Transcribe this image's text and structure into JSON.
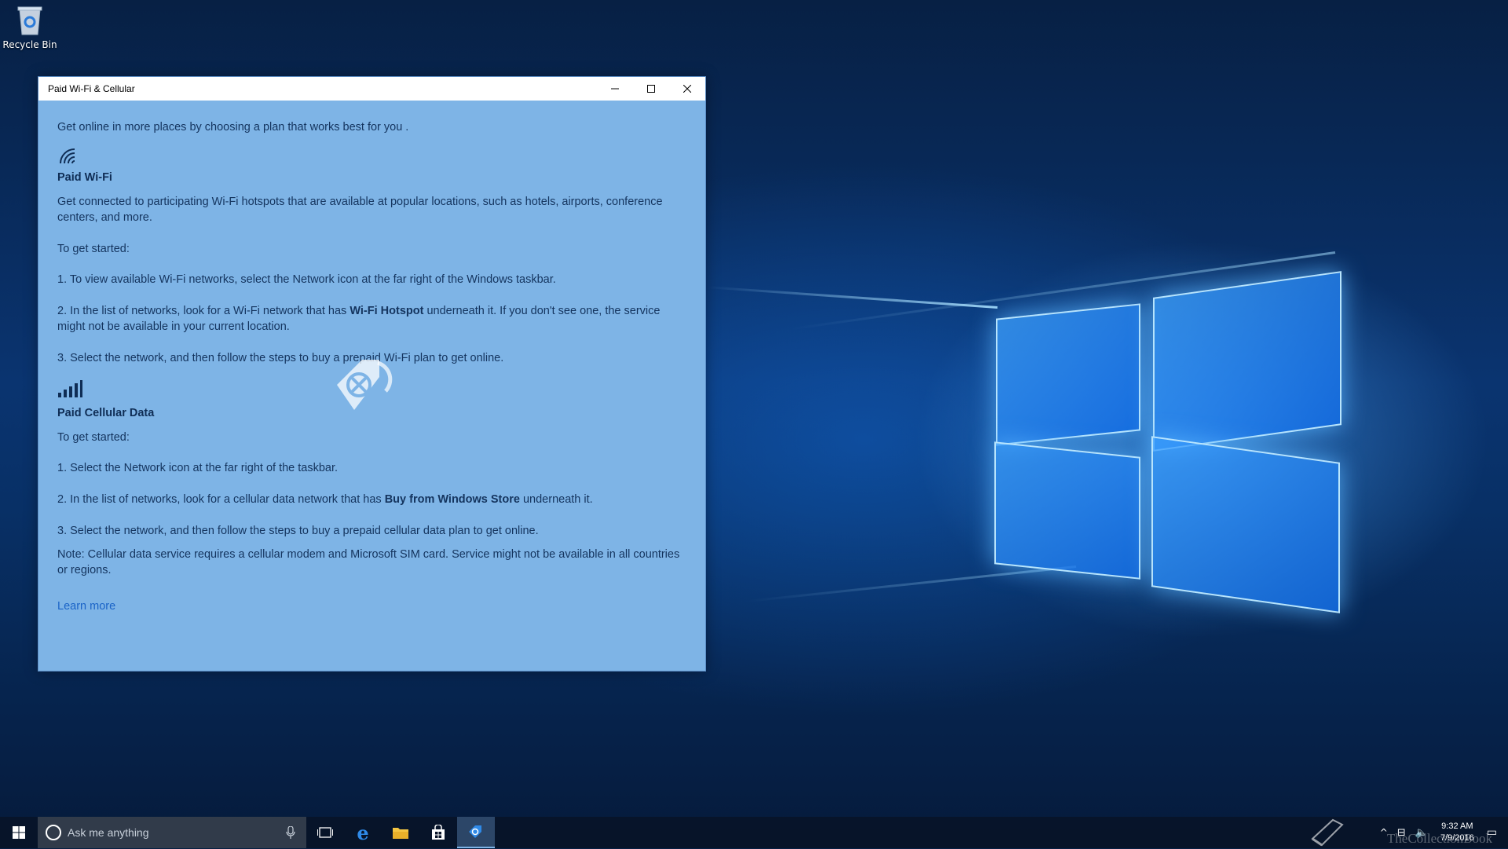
{
  "desktop": {
    "recycle_bin_label": "Recycle Bin"
  },
  "window": {
    "title": "Paid Wi-Fi & Cellular",
    "controls": {
      "minimize": "–",
      "maximize": "☐",
      "close": "✕"
    },
    "intro": "Get online in more places by choosing a plan that works best for you .",
    "wifi": {
      "heading": "Paid Wi-Fi",
      "description": "Get connected to participating Wi-Fi hotspots that are available at popular locations, such as hotels, airports, conference centers, and more.",
      "start": "To get started:",
      "step1": "1. To view available Wi-Fi networks, select the Network icon at the far right of the Windows taskbar.",
      "step2_a": "2. In the list of networks, look for a Wi-Fi network that has ",
      "step2_bold": "Wi-Fi Hotspot",
      "step2_b": " underneath it. If you don't see one, the service might not be available in your current location.",
      "step3": "3. Select the network, and then follow the steps to buy a prepaid Wi-Fi plan to get online."
    },
    "cellular": {
      "heading": "Paid Cellular Data",
      "start": "To get started:",
      "step1": "1. Select the Network icon at the far right of the taskbar.",
      "step2_a": "2. In the list of networks, look for a cellular data network that has ",
      "step2_bold": "Buy from Windows Store",
      "step2_b": " underneath it.",
      "step3": "3. Select the network, and then follow the steps to buy a prepaid cellular data plan to get online.",
      "note": "Note: Cellular data service requires a cellular modem and Microsoft SIM card. Service might not be available in all countries or regions."
    },
    "learn_more": "Learn more"
  },
  "taskbar": {
    "search_placeholder": "Ask me anything",
    "clock_time": "9:32 AM",
    "clock_date": "7/9/2016",
    "watermark": "TheCollectionBook"
  }
}
